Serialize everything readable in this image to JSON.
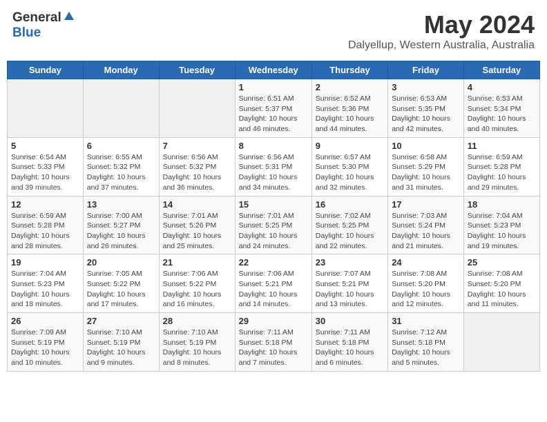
{
  "header": {
    "logo_general": "General",
    "logo_blue": "Blue",
    "title": "May 2024",
    "subtitle": "Dalyellup, Western Australia, Australia"
  },
  "days_of_week": [
    "Sunday",
    "Monday",
    "Tuesday",
    "Wednesday",
    "Thursday",
    "Friday",
    "Saturday"
  ],
  "weeks": [
    [
      {
        "day": "",
        "info": ""
      },
      {
        "day": "",
        "info": ""
      },
      {
        "day": "",
        "info": ""
      },
      {
        "day": "1",
        "info": "Sunrise: 6:51 AM\nSunset: 5:37 PM\nDaylight: 10 hours\nand 46 minutes."
      },
      {
        "day": "2",
        "info": "Sunrise: 6:52 AM\nSunset: 5:36 PM\nDaylight: 10 hours\nand 44 minutes."
      },
      {
        "day": "3",
        "info": "Sunrise: 6:53 AM\nSunset: 5:35 PM\nDaylight: 10 hours\nand 42 minutes."
      },
      {
        "day": "4",
        "info": "Sunrise: 6:53 AM\nSunset: 5:34 PM\nDaylight: 10 hours\nand 40 minutes."
      }
    ],
    [
      {
        "day": "5",
        "info": "Sunrise: 6:54 AM\nSunset: 5:33 PM\nDaylight: 10 hours\nand 39 minutes."
      },
      {
        "day": "6",
        "info": "Sunrise: 6:55 AM\nSunset: 5:32 PM\nDaylight: 10 hours\nand 37 minutes."
      },
      {
        "day": "7",
        "info": "Sunrise: 6:56 AM\nSunset: 5:32 PM\nDaylight: 10 hours\nand 36 minutes."
      },
      {
        "day": "8",
        "info": "Sunrise: 6:56 AM\nSunset: 5:31 PM\nDaylight: 10 hours\nand 34 minutes."
      },
      {
        "day": "9",
        "info": "Sunrise: 6:57 AM\nSunset: 5:30 PM\nDaylight: 10 hours\nand 32 minutes."
      },
      {
        "day": "10",
        "info": "Sunrise: 6:58 AM\nSunset: 5:29 PM\nDaylight: 10 hours\nand 31 minutes."
      },
      {
        "day": "11",
        "info": "Sunrise: 6:59 AM\nSunset: 5:28 PM\nDaylight: 10 hours\nand 29 minutes."
      }
    ],
    [
      {
        "day": "12",
        "info": "Sunrise: 6:59 AM\nSunset: 5:28 PM\nDaylight: 10 hours\nand 28 minutes."
      },
      {
        "day": "13",
        "info": "Sunrise: 7:00 AM\nSunset: 5:27 PM\nDaylight: 10 hours\nand 26 minutes."
      },
      {
        "day": "14",
        "info": "Sunrise: 7:01 AM\nSunset: 5:26 PM\nDaylight: 10 hours\nand 25 minutes."
      },
      {
        "day": "15",
        "info": "Sunrise: 7:01 AM\nSunset: 5:25 PM\nDaylight: 10 hours\nand 24 minutes."
      },
      {
        "day": "16",
        "info": "Sunrise: 7:02 AM\nSunset: 5:25 PM\nDaylight: 10 hours\nand 22 minutes."
      },
      {
        "day": "17",
        "info": "Sunrise: 7:03 AM\nSunset: 5:24 PM\nDaylight: 10 hours\nand 21 minutes."
      },
      {
        "day": "18",
        "info": "Sunrise: 7:04 AM\nSunset: 5:23 PM\nDaylight: 10 hours\nand 19 minutes."
      }
    ],
    [
      {
        "day": "19",
        "info": "Sunrise: 7:04 AM\nSunset: 5:23 PM\nDaylight: 10 hours\nand 18 minutes."
      },
      {
        "day": "20",
        "info": "Sunrise: 7:05 AM\nSunset: 5:22 PM\nDaylight: 10 hours\nand 17 minutes."
      },
      {
        "day": "21",
        "info": "Sunrise: 7:06 AM\nSunset: 5:22 PM\nDaylight: 10 hours\nand 16 minutes."
      },
      {
        "day": "22",
        "info": "Sunrise: 7:06 AM\nSunset: 5:21 PM\nDaylight: 10 hours\nand 14 minutes."
      },
      {
        "day": "23",
        "info": "Sunrise: 7:07 AM\nSunset: 5:21 PM\nDaylight: 10 hours\nand 13 minutes."
      },
      {
        "day": "24",
        "info": "Sunrise: 7:08 AM\nSunset: 5:20 PM\nDaylight: 10 hours\nand 12 minutes."
      },
      {
        "day": "25",
        "info": "Sunrise: 7:08 AM\nSunset: 5:20 PM\nDaylight: 10 hours\nand 11 minutes."
      }
    ],
    [
      {
        "day": "26",
        "info": "Sunrise: 7:09 AM\nSunset: 5:19 PM\nDaylight: 10 hours\nand 10 minutes."
      },
      {
        "day": "27",
        "info": "Sunrise: 7:10 AM\nSunset: 5:19 PM\nDaylight: 10 hours\nand 9 minutes."
      },
      {
        "day": "28",
        "info": "Sunrise: 7:10 AM\nSunset: 5:19 PM\nDaylight: 10 hours\nand 8 minutes."
      },
      {
        "day": "29",
        "info": "Sunrise: 7:11 AM\nSunset: 5:18 PM\nDaylight: 10 hours\nand 7 minutes."
      },
      {
        "day": "30",
        "info": "Sunrise: 7:11 AM\nSunset: 5:18 PM\nDaylight: 10 hours\nand 6 minutes."
      },
      {
        "day": "31",
        "info": "Sunrise: 7:12 AM\nSunset: 5:18 PM\nDaylight: 10 hours\nand 5 minutes."
      },
      {
        "day": "",
        "info": ""
      }
    ]
  ]
}
